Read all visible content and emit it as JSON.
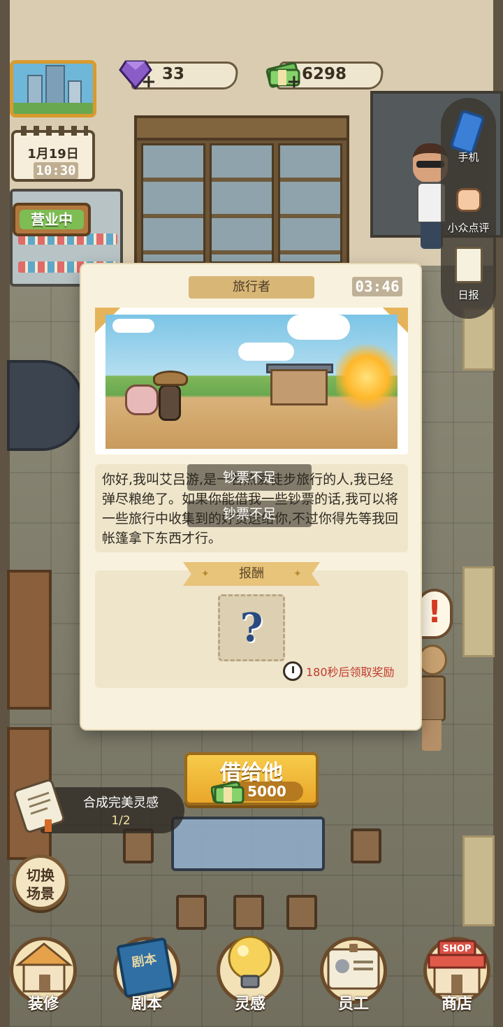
{
  "hud": {
    "gems": "33",
    "cash": "6298",
    "gem_plus": "+",
    "cash_plus": "+",
    "calendar_date": "1月19日",
    "calendar_time": "10:30",
    "status_sign": "营业中"
  },
  "side_menu": {
    "phone_label": "手机",
    "review_label": "小众点评",
    "report_label": "日报"
  },
  "modal": {
    "title": "旅行者",
    "timer": "03:46",
    "dialog": "你好,我叫艾吕游,是一名热爱徒步旅行的人,我已经弹尽粮绝了。如果你能借我一些钞票的话,我可以将一些旅行中收集到的好货送给你,不过你得先等我回帐篷拿下东西才行。",
    "toast_1": "钞票不足",
    "toast_2": "钞票不足",
    "reward_title": "报酬",
    "reward_placeholder": "?",
    "reward_note": "180秒后领取奖励"
  },
  "lend_button": {
    "label": "借给他",
    "price": "5000"
  },
  "quest": {
    "title": "合成完美灵感",
    "progress": "1/2"
  },
  "switch_scene": {
    "line1": "切换",
    "line2": "场景"
  },
  "bottom_nav": [
    {
      "label": "装修",
      "icon": "shop-renovate-icon"
    },
    {
      "label": "剧本",
      "icon": "script-book-icon"
    },
    {
      "label": "灵感",
      "icon": "lightbulb-icon"
    },
    {
      "label": "员工",
      "icon": "staff-badge-icon"
    },
    {
      "label": "商店",
      "icon": "store-icon"
    }
  ],
  "script_book_text": "剧本",
  "shop_sign_text": "SHOP",
  "colors": {
    "accent_gold": "#e9a72a",
    "panel_cream": "#f8f1dd",
    "warning_red": "#c0392b",
    "open_green": "#7dbd54"
  }
}
